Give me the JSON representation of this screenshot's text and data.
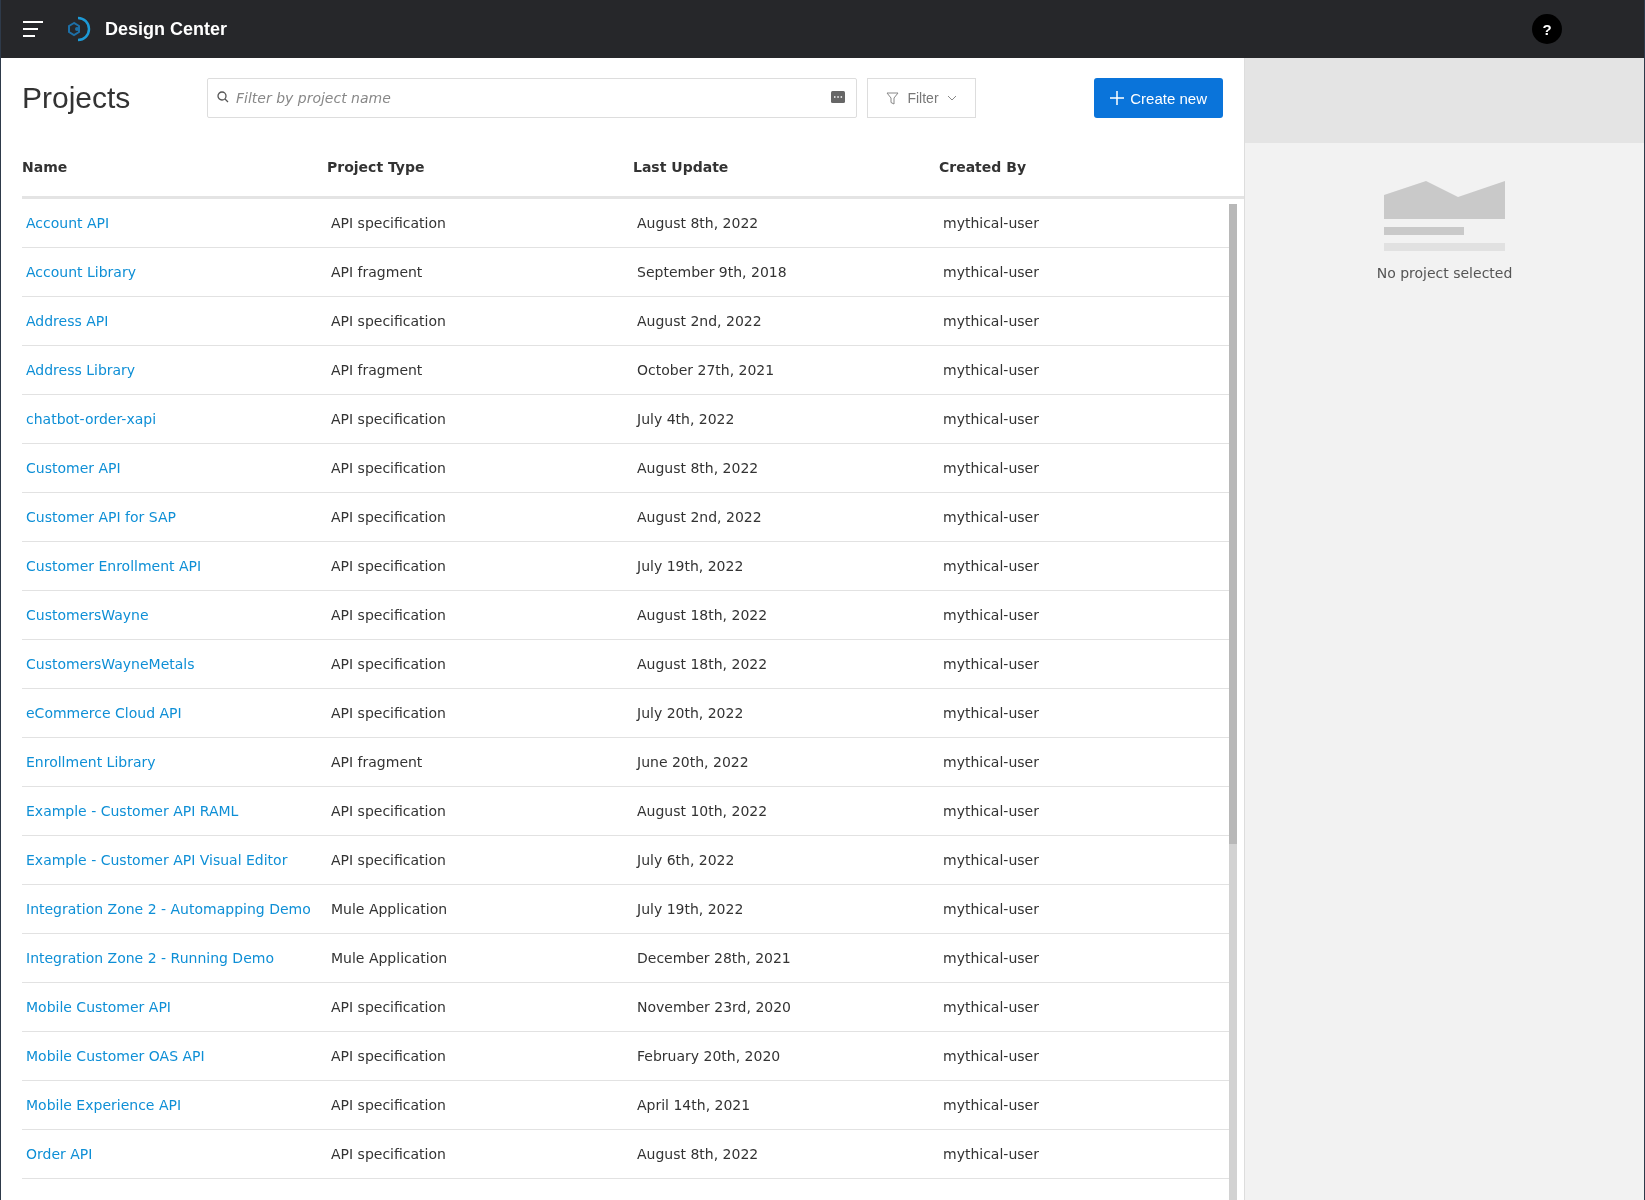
{
  "app_bar": {
    "title": "Design Center",
    "help": "?"
  },
  "toolbar": {
    "title": "Projects",
    "search": {
      "placeholder": "Filter by project name"
    },
    "filter_button": "Filter",
    "create_button": "Create new"
  },
  "table": {
    "columns": [
      "Name",
      "Project Type",
      "Last Update",
      "Created By"
    ],
    "rows": [
      [
        "Account API",
        "API specification",
        "August 8th, 2022",
        "mythical-user"
      ],
      [
        "Account Library",
        "API fragment",
        "September 9th, 2018",
        "mythical-user"
      ],
      [
        "Address API",
        "API specification",
        "August 2nd, 2022",
        "mythical-user"
      ],
      [
        "Address Library",
        "API fragment",
        "October 27th, 2021",
        "mythical-user"
      ],
      [
        "chatbot-order-xapi",
        "API specification",
        "July 4th, 2022",
        "mythical-user"
      ],
      [
        "Customer API",
        "API specification",
        "August 8th, 2022",
        "mythical-user"
      ],
      [
        "Customer API for SAP",
        "API specification",
        "August 2nd, 2022",
        "mythical-user"
      ],
      [
        "Customer Enrollment API",
        "API specification",
        "July 19th, 2022",
        "mythical-user"
      ],
      [
        "CustomersWayne",
        "API specification",
        "August 18th, 2022",
        "mythical-user"
      ],
      [
        "CustomersWayneMetals",
        "API specification",
        "August 18th, 2022",
        "mythical-user"
      ],
      [
        "eCommerce Cloud API",
        "API specification",
        "July 20th, 2022",
        "mythical-user"
      ],
      [
        "Enrollment Library",
        "API fragment",
        "June 20th, 2022",
        "mythical-user"
      ],
      [
        "Example - Customer API RAML",
        "API specification",
        "August 10th, 2022",
        "mythical-user"
      ],
      [
        "Example - Customer API Visual Editor",
        "API specification",
        "July 6th, 2022",
        "mythical-user"
      ],
      [
        "Integration Zone 2 - Automapping Demo",
        "Mule Application",
        "July 19th, 2022",
        "mythical-user"
      ],
      [
        "Integration Zone 2 - Running Demo",
        "Mule Application",
        "December 28th, 2021",
        "mythical-user"
      ],
      [
        "Mobile Customer API",
        "API specification",
        "November 23rd, 2020",
        "mythical-user"
      ],
      [
        "Mobile Customer OAS API",
        "API specification",
        "February 20th, 2020",
        "mythical-user"
      ],
      [
        "Mobile Experience API",
        "API specification",
        "April 14th, 2021",
        "mythical-user"
      ],
      [
        "Order API",
        "API specification",
        "August 8th, 2022",
        "mythical-user"
      ]
    ]
  },
  "details_panel": {
    "empty_text": "No project selected"
  }
}
